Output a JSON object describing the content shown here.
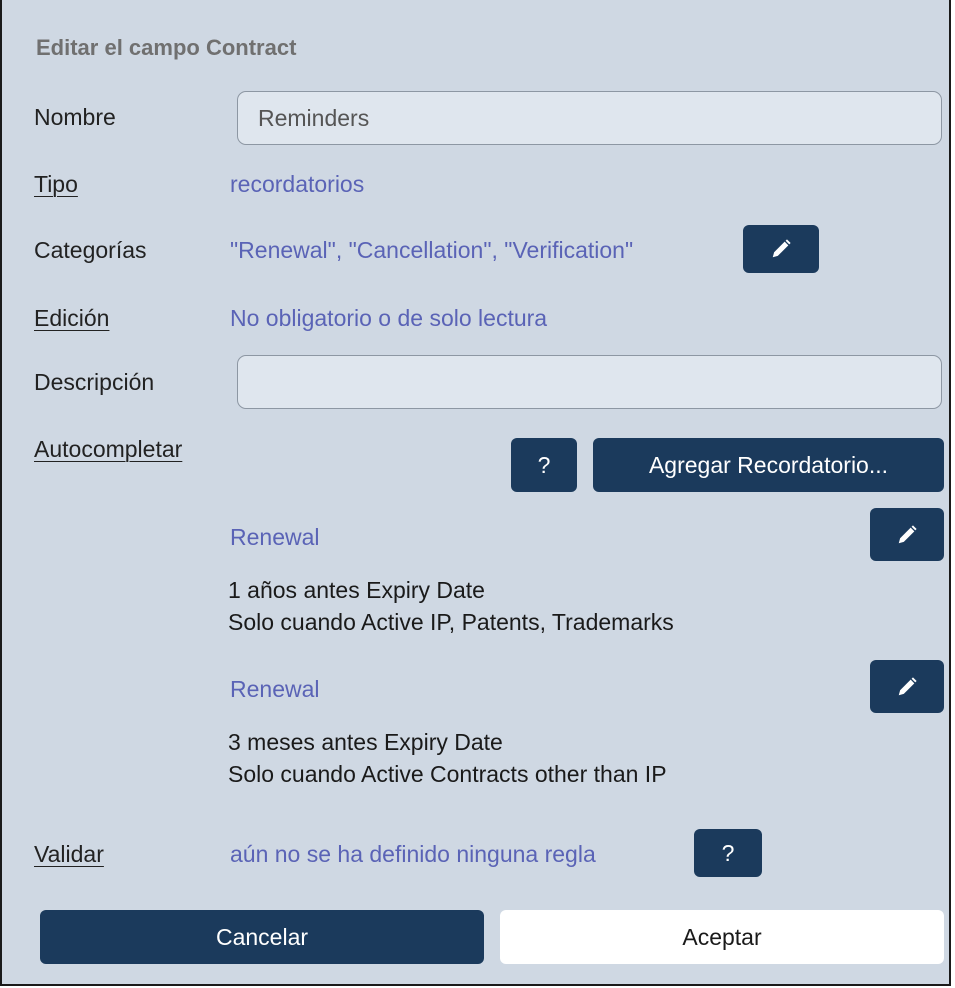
{
  "dialog": {
    "title": "Editar el campo Contract"
  },
  "fields": {
    "name": {
      "label": "Nombre",
      "value": "Reminders"
    },
    "type": {
      "label": "Tipo",
      "value": "recordatorios"
    },
    "categories": {
      "label": "Categorías",
      "value": "\"Renewal\", \"Cancellation\", \"Verification\"",
      "edit_icon": "pencil-icon"
    },
    "editing": {
      "label": "Edición",
      "value": "No obligatorio o de solo lectura"
    },
    "description": {
      "label": "Descripción",
      "value": ""
    },
    "autocomplete": {
      "label": "Autocompletar",
      "help_label": "?",
      "add_label": "Agregar Recordatorio...",
      "reminders": [
        {
          "title": "Renewal",
          "line1": "1 años antes Expiry Date",
          "line2": "Solo cuando Active IP, Patents, Trademarks",
          "edit_icon": "pencil-icon"
        },
        {
          "title": "Renewal",
          "line1": "3 meses antes Expiry Date",
          "line2": "Solo cuando Active Contracts other than IP",
          "edit_icon": "pencil-icon"
        }
      ]
    },
    "validate": {
      "label": "Validar",
      "value": "aún no se ha definido ninguna regla",
      "help_label": "?"
    }
  },
  "footer": {
    "cancel_label": "Cancelar",
    "accept_label": "Aceptar"
  },
  "colors": {
    "background": "#cfd8e3",
    "primary_button": "#1b3a5c",
    "value_text": "#5a63b6"
  }
}
